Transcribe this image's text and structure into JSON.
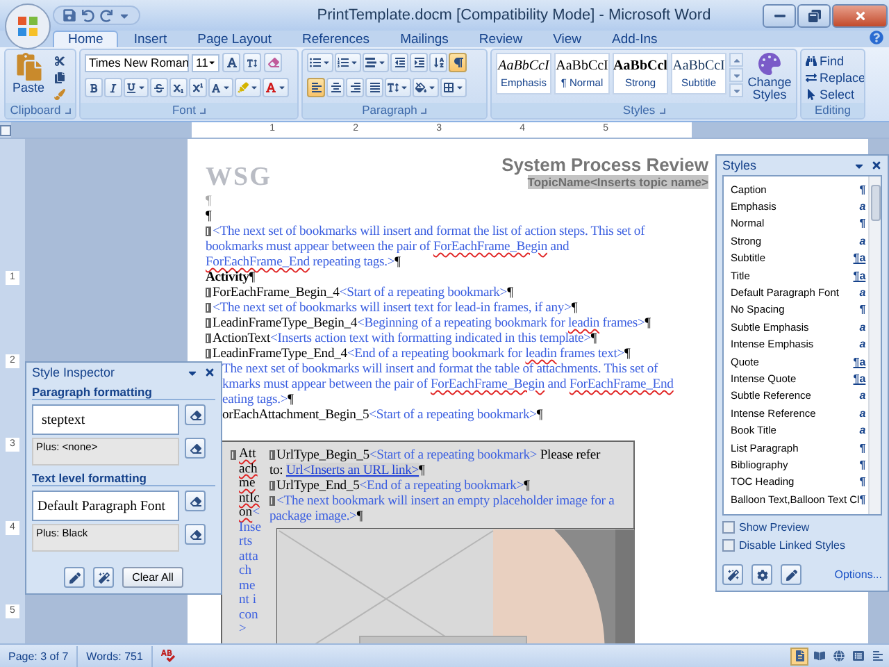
{
  "window": {
    "title": "PrintTemplate.docm [Compatibility Mode] - Microsoft Word"
  },
  "tabs": [
    {
      "label": "Home",
      "selected": true
    },
    {
      "label": "Insert",
      "selected": false
    },
    {
      "label": "Page Layout",
      "selected": false
    },
    {
      "label": "References",
      "selected": false
    },
    {
      "label": "Mailings",
      "selected": false
    },
    {
      "label": "Review",
      "selected": false
    },
    {
      "label": "View",
      "selected": false
    },
    {
      "label": "Add-Ins",
      "selected": false
    }
  ],
  "ribbon": {
    "clipboard": {
      "paste_label": "Paste",
      "group_label": "Clipboard"
    },
    "font": {
      "font_name": "Times New Roman",
      "font_size": "11",
      "group_label": "Font"
    },
    "paragraph": {
      "show_formatting_marks": true,
      "alignment": [
        {
          "selected": true
        },
        {
          "selected": false
        },
        {
          "selected": false
        },
        {
          "selected": false
        }
      ],
      "group_label": "Paragraph"
    },
    "styles": {
      "gallery": [
        {
          "sample": "AaBbCcI",
          "label": "Emphasis",
          "kind": "emphasis"
        },
        {
          "sample": "AaBbCcI",
          "label": "¶ Normal",
          "kind": "normal"
        },
        {
          "sample": "AaBbCcl",
          "label": "Strong",
          "kind": "strong"
        },
        {
          "sample": "AaBbCcI",
          "label": "Subtitle",
          "kind": "subtitle"
        }
      ],
      "change_styles": "Change Styles",
      "group_label": "Styles"
    },
    "editing": {
      "find": "Find",
      "replace": "Replace",
      "select": "Select",
      "group_label": "Editing"
    }
  },
  "ruler": {
    "numbers": [
      "1",
      "2",
      "3",
      "4",
      "5"
    ]
  },
  "vertical_ruler": {
    "numbers": [
      "1",
      "2",
      "3",
      "4",
      "5"
    ]
  },
  "document": {
    "logo": "WSG",
    "title": "System Process Review",
    "topic": "TopicName<Inserts topic name>",
    "lines": [
      {
        "kind": "normal",
        "marker": false,
        "segments": [
          {
            "kind": "mark_gray",
            "text": "¶"
          }
        ]
      },
      {
        "kind": "normal",
        "marker": false,
        "segments": [
          {
            "kind": "mark",
            "text": "¶"
          }
        ]
      },
      {
        "kind": "normal",
        "marker": true,
        "segments": [
          {
            "kind": "hint",
            "text": "<The next set of bookmarks will insert and format the list of action steps. This set of"
          }
        ]
      },
      {
        "kind": "normal",
        "marker": false,
        "segments": [
          {
            "kind": "hint",
            "text": "bookmarks must appear between the pair of "
          },
          {
            "kind": "hint_err",
            "text": "ForEachFrame_Begin"
          },
          {
            "kind": "hint",
            "text": " and"
          }
        ]
      },
      {
        "kind": "normal",
        "marker": false,
        "segments": [
          {
            "kind": "hint_err",
            "text": "ForEachFrame_End"
          },
          {
            "kind": "hint",
            "text": " repeating tags.>"
          },
          {
            "kind": "mark",
            "text": "¶"
          }
        ]
      },
      {
        "kind": "normal",
        "marker": false,
        "segments": [
          {
            "kind": "bold",
            "text": "Activity"
          },
          {
            "kind": "mark",
            "text": "¶"
          }
        ]
      },
      {
        "kind": "normal",
        "marker": true,
        "segments": [
          {
            "kind": "plain",
            "text": "ForEachFrame_Begin_4"
          },
          {
            "kind": "hint",
            "text": "<Start of a repeating bookmark>"
          },
          {
            "kind": "mark",
            "text": "¶"
          }
        ]
      },
      {
        "kind": "normal",
        "marker": true,
        "segments": [
          {
            "kind": "hint",
            "text": "<The next set of bookmarks will insert text for lead-in frames, if any>"
          },
          {
            "kind": "mark",
            "text": "¶"
          }
        ]
      },
      {
        "kind": "normal",
        "marker": true,
        "segments": [
          {
            "kind": "plain",
            "text": "LeadinFrameType_Begin_4"
          },
          {
            "kind": "hint",
            "text": "<Beginning of a repeating bookmark for "
          },
          {
            "kind": "hint_err",
            "text": "leadin"
          },
          {
            "kind": "hint",
            "text": " frames>"
          },
          {
            "kind": "mark",
            "text": "¶"
          }
        ]
      },
      {
        "kind": "normal",
        "marker": true,
        "segments": [
          {
            "kind": "plain",
            "text": "ActionText"
          },
          {
            "kind": "hint",
            "text": "<Inserts action text with formatting indicated in this template>"
          },
          {
            "kind": "mark",
            "text": "¶"
          }
        ]
      },
      {
        "kind": "normal",
        "marker": true,
        "segments": [
          {
            "kind": "plain",
            "text": "LeadinFrameType_End_4"
          },
          {
            "kind": "hint",
            "text": "<End of a repeating bookmark for "
          },
          {
            "kind": "hint_err",
            "text": "leadin"
          },
          {
            "kind": "hint",
            "text": " frames text>"
          },
          {
            "kind": "mark",
            "text": "¶"
          }
        ]
      },
      {
        "kind": "partly_hidden",
        "marker": false,
        "segments": [
          {
            "kind": "hint",
            "text": "The next set of bookmarks will insert and format the table of attachments. This set of"
          }
        ]
      },
      {
        "kind": "partly_hidden",
        "marker": false,
        "segments": [
          {
            "kind": "hint",
            "text": "kmarks must appear between the pair of "
          },
          {
            "kind": "hint_err",
            "text": "ForEachFrame_Begin"
          },
          {
            "kind": "hint",
            "text": " and "
          },
          {
            "kind": "hint_err",
            "text": "ForEachFrame_End"
          }
        ]
      },
      {
        "kind": "partly_hidden",
        "marker": false,
        "segments": [
          {
            "kind": "hint",
            "text": "eating tags.>"
          },
          {
            "kind": "mark",
            "text": "¶"
          }
        ]
      },
      {
        "kind": "partly_hidden",
        "marker": false,
        "segments": [
          {
            "kind": "plain",
            "text": "orEachAttachment_Begin_5"
          },
          {
            "kind": "hint",
            "text": "<Start of a repeating bookmark>"
          },
          {
            "kind": "mark",
            "text": "¶"
          }
        ]
      }
    ],
    "table": {
      "left_cell": [
        {
          "kind": "plain_err",
          "text": "AttachmentIcon"
        },
        {
          "kind": "hint",
          "text": "<Inserts attachment icon>"
        }
      ],
      "lines": [
        {
          "marker": true,
          "segments": [
            {
              "kind": "plain",
              "text": "UrlType_Begin_5"
            },
            {
              "kind": "hint",
              "text": "<Start of a repeating bookmark>"
            },
            {
              "kind": "plain",
              "text": " Please refer"
            }
          ]
        },
        {
          "marker": false,
          "segments": [
            {
              "kind": "plain",
              "text": "to: "
            },
            {
              "kind": "link",
              "text": "Url<Inserts an URL link>"
            },
            {
              "kind": "mark",
              "text": "¶"
            }
          ]
        },
        {
          "marker": true,
          "segments": [
            {
              "kind": "plain",
              "text": "UrlType_End_5"
            },
            {
              "kind": "hint",
              "text": "<End of a repeating bookmark>"
            },
            {
              "kind": "mark",
              "text": "¶"
            }
          ]
        },
        {
          "marker": true,
          "segments": [
            {
              "kind": "hint",
              "text": "<The next bookmark will insert an empty placeholder image for a"
            }
          ]
        },
        {
          "marker": false,
          "segments": [
            {
              "kind": "hint",
              "text": "package image.>"
            },
            {
              "kind": "mark",
              "text": "¶"
            }
          ]
        }
      ]
    }
  },
  "style_inspector": {
    "title": "Style Inspector",
    "paragraph_heading": "Paragraph formatting",
    "paragraph_style": "steptext",
    "paragraph_plus": "Plus: <none>",
    "text_heading": "Text level formatting",
    "text_style": "Default Paragraph Font",
    "text_plus": "Plus: Black",
    "clear_button": "Clear All"
  },
  "styles_pane": {
    "title": "Styles",
    "items": [
      {
        "name": "Caption",
        "mark": "¶",
        "kind": "paragraph"
      },
      {
        "name": "Emphasis",
        "mark": "a",
        "kind": "character"
      },
      {
        "name": "Normal",
        "mark": "¶",
        "kind": "paragraph"
      },
      {
        "name": "Strong",
        "mark": "a",
        "kind": "character"
      },
      {
        "name": "Subtitle",
        "mark": "¶a",
        "kind": "linked"
      },
      {
        "name": "Title",
        "mark": "¶a",
        "kind": "linked"
      },
      {
        "name": "Default Paragraph Font",
        "mark": "a",
        "kind": "character"
      },
      {
        "name": "No Spacing",
        "mark": "¶",
        "kind": "paragraph"
      },
      {
        "name": "Subtle Emphasis",
        "mark": "a",
        "kind": "character"
      },
      {
        "name": "Intense Emphasis",
        "mark": "a",
        "kind": "character"
      },
      {
        "name": "Quote",
        "mark": "¶a",
        "kind": "linked"
      },
      {
        "name": "Intense Quote",
        "mark": "¶a",
        "kind": "linked"
      },
      {
        "name": "Subtle Reference",
        "mark": "a",
        "kind": "character"
      },
      {
        "name": "Intense Reference",
        "mark": "a",
        "kind": "character"
      },
      {
        "name": "Book Title",
        "mark": "a",
        "kind": "character"
      },
      {
        "name": "List Paragraph",
        "mark": "¶",
        "kind": "paragraph"
      },
      {
        "name": "Bibliography",
        "mark": "¶",
        "kind": "paragraph"
      },
      {
        "name": "TOC Heading",
        "mark": "¶",
        "kind": "paragraph"
      },
      {
        "name": "Balloon Text,Balloon Text Cl",
        "mark": "¶",
        "kind": "paragraph"
      }
    ],
    "checkboxes": [
      {
        "label": "Show Preview",
        "checked": false
      },
      {
        "label": "Disable Linked Styles",
        "checked": false
      }
    ],
    "options_link": "Options..."
  },
  "status_bar": {
    "page": "Page: 3 of 7",
    "words": "Words: 751",
    "views": [
      {
        "selected": true
      },
      {
        "selected": false
      },
      {
        "selected": false
      },
      {
        "selected": false
      },
      {
        "selected": false
      }
    ]
  }
}
